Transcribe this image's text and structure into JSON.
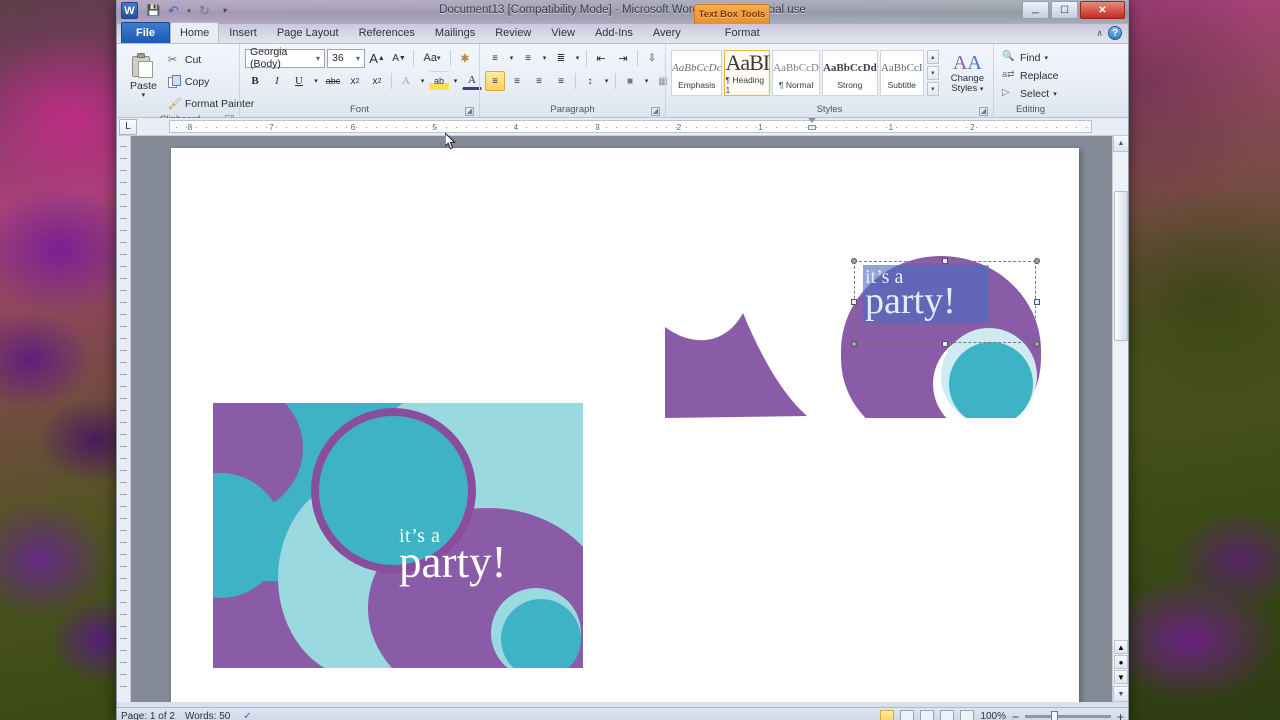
{
  "window": {
    "title": "Document13 [Compatibility Mode] - Microsoft Word non-commercial use",
    "app_icon": "word-icon",
    "quick_access": [
      {
        "name": "save-icon",
        "glyph": "💾"
      },
      {
        "name": "undo-icon",
        "glyph": "↶"
      },
      {
        "name": "undo-dropdown-icon",
        "glyph": "▾"
      },
      {
        "name": "redo-icon",
        "glyph": "↻"
      },
      {
        "name": "customize-qat-icon",
        "glyph": "▾"
      }
    ],
    "controls": {
      "minimize": "—",
      "maximize": "❐",
      "close": "✕"
    },
    "contextual_tab_title": "Text Box Tools",
    "help_icon": "?",
    "minimize_ribbon_icon": "∧"
  },
  "tabs": [
    {
      "label": "File",
      "kind": "file"
    },
    {
      "label": "Home",
      "kind": "active"
    },
    {
      "label": "Insert",
      "kind": "normal"
    },
    {
      "label": "Page Layout",
      "kind": "normal"
    },
    {
      "label": "References",
      "kind": "normal"
    },
    {
      "label": "Mailings",
      "kind": "normal"
    },
    {
      "label": "Review",
      "kind": "normal"
    },
    {
      "label": "View",
      "kind": "normal"
    },
    {
      "label": "Add-Ins",
      "kind": "normal"
    },
    {
      "label": "Avery",
      "kind": "normal"
    },
    {
      "label": "Format",
      "kind": "contextual"
    }
  ],
  "ribbon": {
    "clipboard": {
      "group_label": "Clipboard",
      "paste_label": "Paste",
      "paste_arrow": "▾",
      "cut_label": "Cut",
      "copy_label": "Copy",
      "format_painter_label": "Format Painter",
      "dialog_launcher": "↘"
    },
    "font": {
      "group_label": "Font",
      "font_name": "Georgia (Body)",
      "font_size": "36",
      "dropdown_arrow": "▾",
      "grow_font": "A",
      "shrink_font": "A",
      "change_case": "Aa",
      "clear_formatting": "✐",
      "bold": "B",
      "italic": "I",
      "underline": "U",
      "strikethrough": "abc",
      "subscript": "x₂",
      "superscript": "x²",
      "text_effects": "A",
      "highlight": "ab",
      "font_color": "A",
      "dialog_launcher": "↘"
    },
    "paragraph": {
      "group_label": "Paragraph",
      "bullets": "≡",
      "numbering": "≡",
      "multilevel": "≡",
      "decrease_indent": "⇤",
      "increase_indent": "⇥",
      "sort": "↓",
      "show_marks": "¶",
      "align_left": "≡",
      "align_center": "≡",
      "align_right": "≡",
      "justify": "≡",
      "line_spacing": "↕",
      "shading": "▤",
      "borders": "▦",
      "dialog_launcher": "↘"
    },
    "styles": {
      "group_label": "Styles",
      "items": [
        {
          "preview": "AaBbCcDc",
          "name": "Emphasis",
          "kind": "em",
          "selected": false
        },
        {
          "preview": "AaBI",
          "name": "¶ Heading 1",
          "kind": "h1",
          "selected": true
        },
        {
          "preview": "AaBbCcD",
          "name": "¶ Normal",
          "kind": "norm",
          "selected": false
        },
        {
          "preview": "AaBbCcDd",
          "name": "Strong",
          "kind": "strong",
          "selected": false
        },
        {
          "preview": "AaBbCcI",
          "name": "Subtitle",
          "kind": "sub",
          "selected": false
        }
      ],
      "scroll_up": "▴",
      "scroll_down": "▾",
      "more": "▾",
      "change_styles_label": "Change\nStyles",
      "change_styles_arrow": "▾",
      "dialog_launcher": "↘"
    },
    "editing": {
      "group_label": "Editing",
      "find_label": "Find",
      "find_arrow": "▾",
      "replace_label": "Replace",
      "select_label": "Select",
      "select_arrow": "▾"
    }
  },
  "ruler": {
    "tab_selector_glyph": "L",
    "left_numbers": [
      "8",
      "7",
      "6",
      "5",
      "4",
      "3",
      "2",
      "1"
    ],
    "right_numbers": [
      "1",
      "2"
    ]
  },
  "document": {
    "card": {
      "text_line1": "it’s a",
      "text_line2": "party!",
      "colors": {
        "teal": "#3fb3c6",
        "light_teal": "#9ad9e0",
        "purple": "#8a5ba6",
        "dark_purple": "#7c4e99",
        "white": "#ffffff"
      }
    },
    "selected_textbox": {
      "text_line1": "it’s a",
      "text_line2": "party!",
      "selection_color": "#4a6ec0"
    }
  },
  "statusbar": {
    "page": "Page: 1 of 2",
    "words": "Words: 50",
    "proofing_icon": "spell-check-icon",
    "zoom": "100%",
    "zoom_out": "−",
    "zoom_in": "+",
    "views": [
      "print-layout",
      "full-screen-reading",
      "web-layout",
      "outline",
      "draft"
    ]
  }
}
